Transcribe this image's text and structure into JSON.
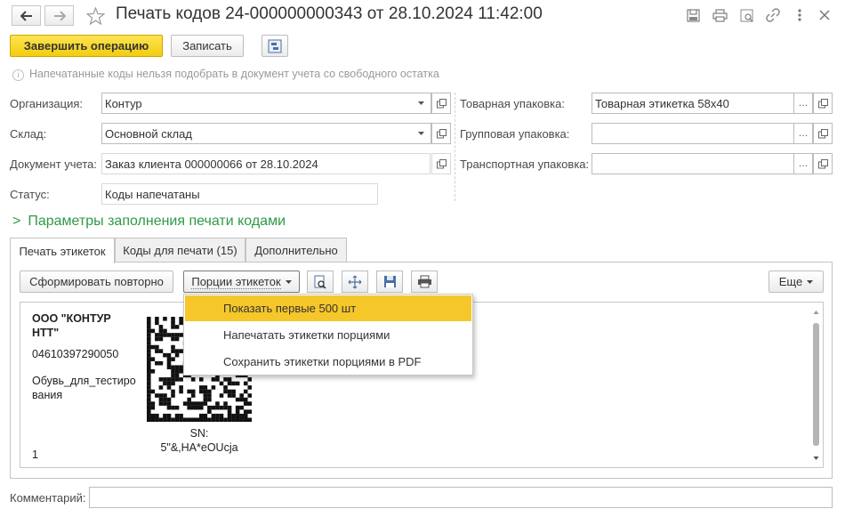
{
  "window": {
    "title": "Печать кодов 24-000000000343 от 28.10.2024 11:42:00"
  },
  "toolbar": {
    "complete_label": "Завершить операцию",
    "save_label": "Записать"
  },
  "hint": {
    "text": "Напечатанные коды нельзя подобрать в документ учета со свободного остатка"
  },
  "form": {
    "organization": {
      "label": "Организация:",
      "value": "Контур"
    },
    "warehouse": {
      "label": "Склад:",
      "value": "Основной склад"
    },
    "document": {
      "label": "Документ учета:",
      "value": "Заказ клиента 000000066 от 28.10.2024"
    },
    "status": {
      "label": "Статус:",
      "value": "Коды напечатаны"
    },
    "goods_pack": {
      "label": "Товарная упаковка:",
      "value": "Товарная этикетка 58х40"
    },
    "group_pack": {
      "label": "Групповая упаковка:",
      "value": ""
    },
    "transport_pack": {
      "label": "Транспортная упаковка:",
      "value": ""
    }
  },
  "section": {
    "chevron": ">",
    "title": "Параметры заполнения печати кодами"
  },
  "tabs": [
    {
      "label": "Печать этикеток",
      "active": true
    },
    {
      "label": "Коды для печати (15)",
      "active": false
    },
    {
      "label": "Дополнительно",
      "active": false
    }
  ],
  "panel_toolbar": {
    "regenerate_label": "Сформировать повторно",
    "portions_label": "Порции этикеток",
    "more_label": "Еще"
  },
  "dropdown": {
    "items": [
      {
        "label": "Показать первые 500 шт",
        "selected": true
      },
      {
        "label": "Напечатать этикетки порциями",
        "selected": false
      },
      {
        "label": "Сохранить этикетки порциями в PDF",
        "selected": false
      }
    ]
  },
  "label_preview": {
    "company_line1": "ООО \"КОНТУР",
    "company_line2": "НТТ\"",
    "gtin": "04610397290050",
    "product_line1": "Обувь_для_тестиро",
    "product_line2": "вания",
    "count": "1",
    "sn_label": "SN:",
    "sn_value": "5\"&,HA*eOUcja"
  },
  "comment": {
    "label": "Комментарий:",
    "value": ""
  },
  "colors": {
    "accent_yellow": "#f6c72a",
    "section_green": "#2f9a45"
  }
}
